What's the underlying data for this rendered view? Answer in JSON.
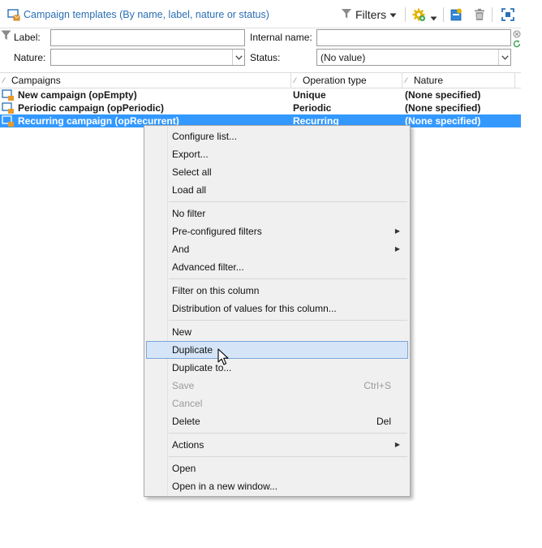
{
  "header": {
    "title": "Campaign templates (By name, label, nature or status)",
    "filters_label": "Filters",
    "icons": [
      "campaign-template-icon",
      "filter-funnel-icon",
      "gear-add-icon",
      "new-item-icon",
      "trash-icon",
      "fit-screen-icon"
    ]
  },
  "filter_form": {
    "label_label": "Label:",
    "label_value": "",
    "internal_name_label": "Internal name:",
    "internal_name_value": "",
    "nature_label": "Nature:",
    "nature_value": "",
    "status_label": "Status:",
    "status_value": "(No value)"
  },
  "grid": {
    "columns": [
      "Campaigns",
      "Operation type",
      "Nature"
    ],
    "rows": [
      {
        "campaign": "New campaign (opEmpty)",
        "operation_type": "Unique",
        "nature": "(None specified)",
        "selected": false
      },
      {
        "campaign": "Periodic campaign (opPeriodic)",
        "operation_type": "Periodic",
        "nature": "(None specified)",
        "selected": false
      },
      {
        "campaign": "Recurring campaign (opRecurrent)",
        "operation_type": "Recurring",
        "nature": "(None specified)",
        "selected": true
      }
    ]
  },
  "context_menu": {
    "items": [
      {
        "label": "Configure list..."
      },
      {
        "label": "Export..."
      },
      {
        "label": "Select all"
      },
      {
        "label": "Load all"
      },
      {
        "label": "No filter"
      },
      {
        "label": "Pre-configured filters",
        "submenu": true
      },
      {
        "label": "And",
        "submenu": true
      },
      {
        "label": "Advanced filter..."
      },
      {
        "label": "Filter on this column"
      },
      {
        "label": "Distribution of values for this column..."
      },
      {
        "label": "New"
      },
      {
        "label": "Duplicate",
        "hover": true
      },
      {
        "label": "Duplicate to..."
      },
      {
        "label": "Save",
        "shortcut": "Ctrl+S",
        "disabled": true
      },
      {
        "label": "Cancel",
        "disabled": true
      },
      {
        "label": "Delete",
        "shortcut": "Del"
      },
      {
        "label": "Actions",
        "submenu": true
      },
      {
        "label": "Open"
      },
      {
        "label": "Open in a new window..."
      }
    ]
  },
  "colors": {
    "title_text": "#2b6fb5",
    "selection": "#3399ff",
    "menu_background": "#f0f0f0",
    "menu_hover": "#d5e5f7",
    "refresh_green": "#3aa655",
    "gear_yellow": "#e2b400"
  }
}
